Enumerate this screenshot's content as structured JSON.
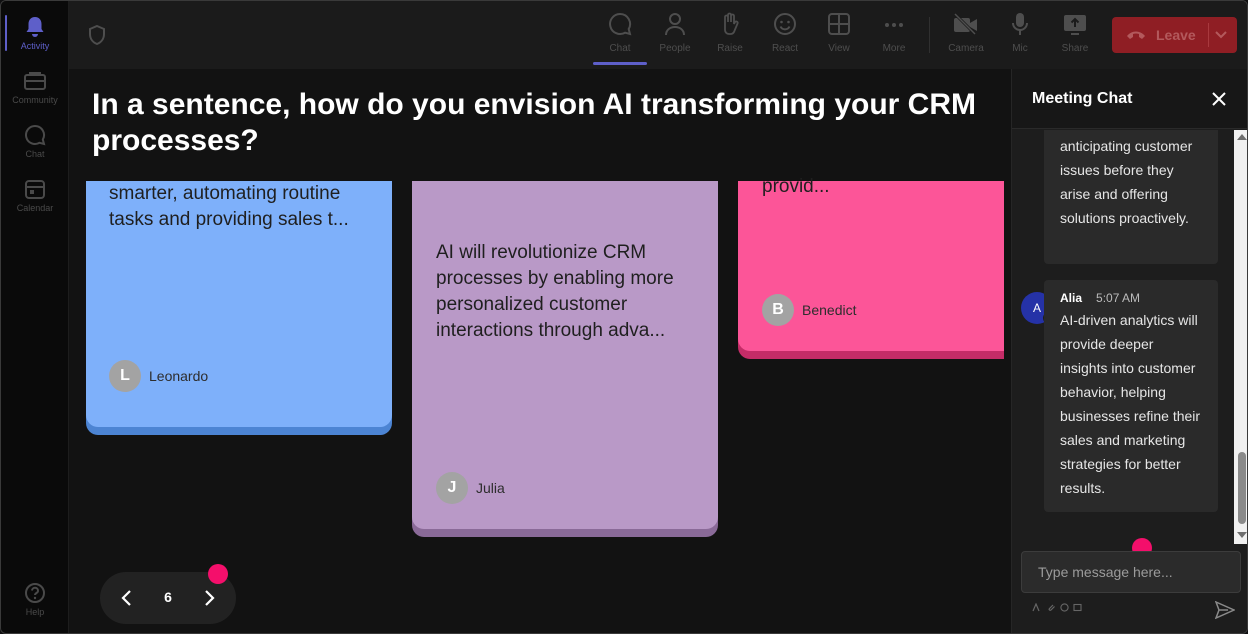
{
  "rail": {
    "items": [
      {
        "label": "Activity",
        "icon": "bell-icon"
      },
      {
        "label": "Community",
        "icon": "community-icon"
      },
      {
        "label": "Chat",
        "icon": "chat-icon"
      },
      {
        "label": "Calendar",
        "icon": "calendar-icon"
      },
      {
        "label": "Help",
        "icon": "help-icon"
      }
    ]
  },
  "toolbar": {
    "buttons": [
      {
        "label": "Chat",
        "icon": "chat-icon"
      },
      {
        "label": "People",
        "icon": "people-icon"
      },
      {
        "label": "Raise",
        "icon": "raise-hand-icon"
      },
      {
        "label": "React",
        "icon": "react-icon"
      },
      {
        "label": "View",
        "icon": "view-icon"
      },
      {
        "label": "More",
        "icon": "more-icon"
      },
      {
        "label": "Camera",
        "icon": "camera-off-icon"
      },
      {
        "label": "Mic",
        "icon": "mic-icon"
      },
      {
        "label": "Share",
        "icon": "share-icon"
      }
    ],
    "leave_label": "Leave",
    "accent": "#5e5fc9",
    "leave_color": "#8f1e24"
  },
  "main": {
    "question": "In a sentence, how do you envision AI transforming your CRM processes?",
    "cards": [
      {
        "text": "smarter, automating routine tasks and providing sales t...",
        "author": "Leonardo",
        "initial": "L",
        "color": "#7eb0fa"
      },
      {
        "text": "AI will revolutionize CRM processes by enabling more personalized customer interactions through adva...",
        "author": "Julia",
        "initial": "J",
        "color": "#b999c7"
      },
      {
        "text": "provid...",
        "author": "Benedict",
        "initial": "B",
        "color": "#fc5598"
      }
    ],
    "pager": {
      "page": "6"
    }
  },
  "chat": {
    "title": "Meeting Chat",
    "messages": [
      {
        "text": "anticipating customer issues before they arise and offering solutions proactively."
      },
      {
        "sender": "Alia",
        "initial": "A",
        "time": "5:07 AM",
        "text": "AI-driven analytics will provide deeper insights into customer behavior, helping businesses refine their sales and marketing strategies for better results."
      }
    ],
    "input_placeholder": "Type message here...",
    "pointer_color": "#f40f6b"
  }
}
